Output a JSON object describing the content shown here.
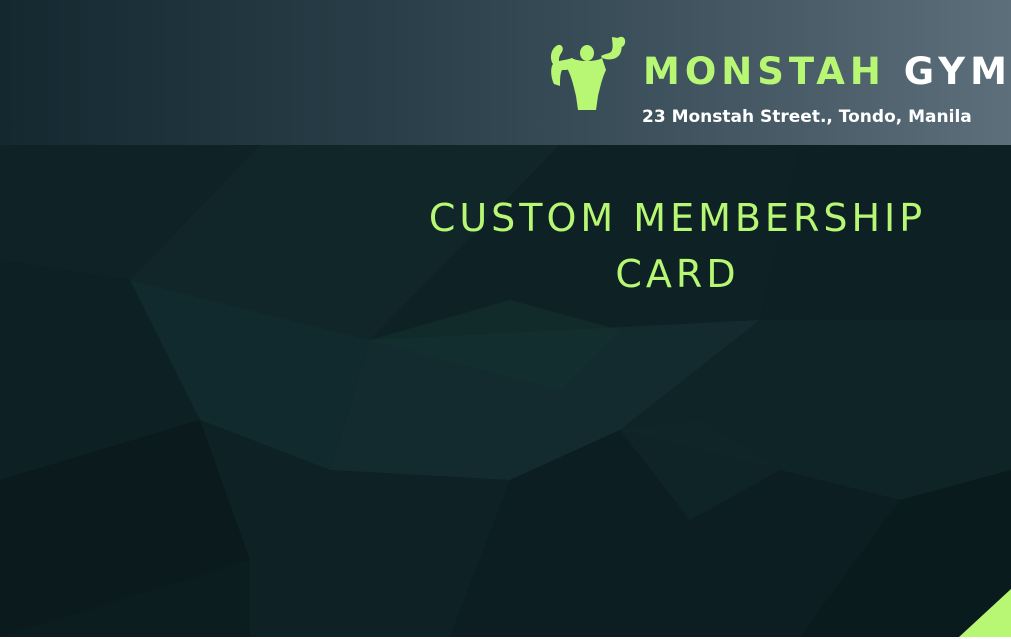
{
  "brand": {
    "name_accent": "MONSTAH",
    "name_rest": "GYM",
    "address": "23 Monstah Street., Tondo, Manila",
    "logo_icon": "flexing-bodybuilder-icon"
  },
  "card": {
    "title_line1": "CUSTOM MEMBERSHIP",
    "title_line2": "CARD"
  },
  "colors": {
    "accent": "#b7f774",
    "background": "#0c1d20",
    "header_start": "#142830",
    "header_end": "#5d6f7b",
    "text_white": "#ffffff"
  }
}
